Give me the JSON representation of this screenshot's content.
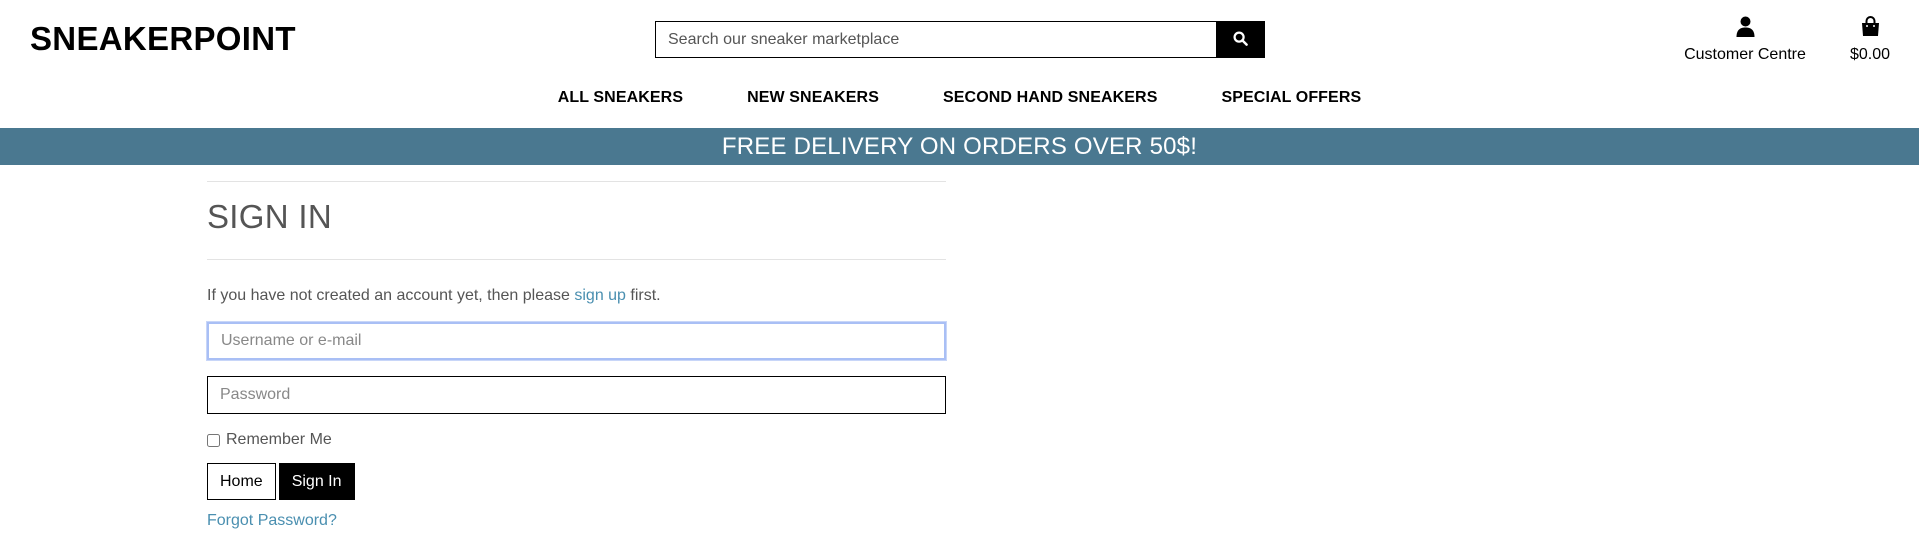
{
  "header": {
    "brand": "SNEAKERPOINT",
    "search": {
      "placeholder": "Search our sneaker marketplace",
      "icon": "search-icon"
    },
    "account": {
      "label": "Customer Centre",
      "icon": "user-icon"
    },
    "cart": {
      "total": "$0.00",
      "icon": "shopping-bag-icon"
    }
  },
  "nav": {
    "items": [
      {
        "label": "ALL SNEAKERS"
      },
      {
        "label": "NEW SNEAKERS"
      },
      {
        "label": "SECOND HAND SNEAKERS"
      },
      {
        "label": "SPECIAL OFFERS"
      }
    ]
  },
  "banner": {
    "text": "FREE DELIVERY ON ORDERS OVER 50$!",
    "color": "#4a7890"
  },
  "signin": {
    "title": "SIGN IN",
    "intro_before": "If you have not created an account yet, then please ",
    "intro_link": "sign up",
    "intro_after": " first.",
    "username_placeholder": "Username or e-mail",
    "username_value": "",
    "password_placeholder": "Password",
    "password_value": "",
    "remember_label": "Remember Me",
    "remember_checked": false,
    "home_button": "Home",
    "signin_button": "Sign In",
    "forgot_link": "Forgot Password?",
    "link_color": "#4a8fb0"
  }
}
